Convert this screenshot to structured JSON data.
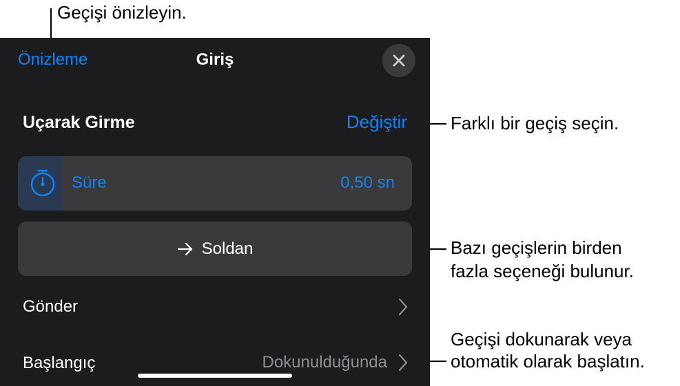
{
  "callouts": {
    "preview": "Geçişi önizleyin.",
    "change_line1": "Farklı bir geçiş seçin.",
    "options_line1": "Bazı geçişlerin birden",
    "options_line2": "fazla seçeneği bulunur.",
    "start_line1": "Geçişi dokunarak veya",
    "start_line2": "otomatik olarak başlatın."
  },
  "nav": {
    "preview": "Önizleme",
    "title": "Giriş",
    "close_icon": "close-icon"
  },
  "effect": {
    "name": "Uçarak Girme",
    "change": "Değiştir"
  },
  "duration": {
    "icon": "stopwatch-icon",
    "label": "Süre",
    "value": "0,50 sn"
  },
  "direction": {
    "icon": "arrow-right-icon",
    "label": "Soldan"
  },
  "rows": {
    "deliver_label": "Gönder",
    "start_label": "Başlangıç",
    "start_value": "Dokunulduğunda"
  },
  "colors": {
    "accent": "#0a84ff",
    "panel_bg": "#1c1c1e",
    "control_bg": "#3a3a3c",
    "secondary_text": "#8e8e93"
  }
}
